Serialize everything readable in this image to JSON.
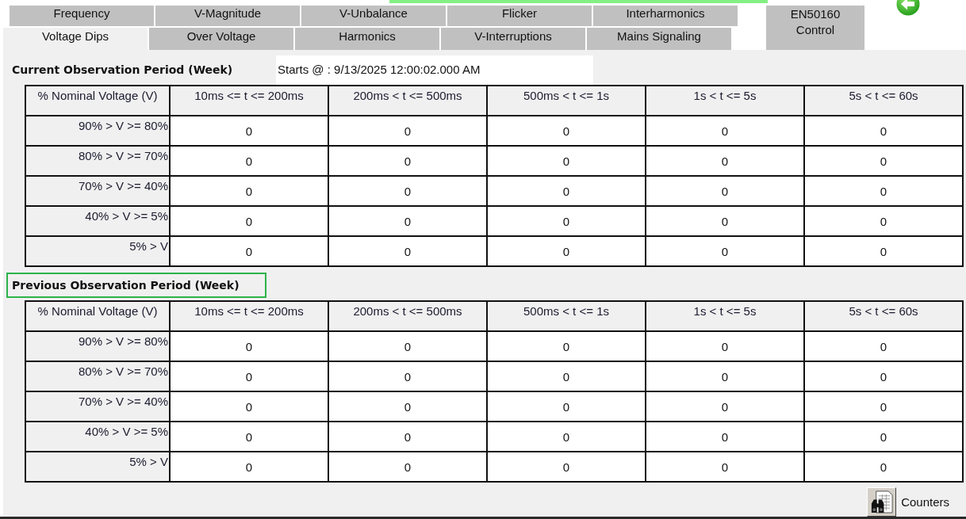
{
  "tabs": {
    "row_1": [
      {
        "label": "Frequency",
        "selected": false
      },
      {
        "label": "V-Magnitude",
        "selected": false
      },
      {
        "label": "V-Unbalance",
        "selected": false
      },
      {
        "label": "Flicker",
        "selected": false
      },
      {
        "label": "Interharmonics",
        "selected": false
      }
    ],
    "row_2": [
      {
        "label": "Voltage Dips",
        "selected": true
      },
      {
        "label": "Over Voltage",
        "selected": false
      },
      {
        "label": "Harmonics",
        "selected": false
      },
      {
        "label": "V-Interruptions",
        "selected": false
      },
      {
        "label": "Mains Signaling",
        "selected": false
      }
    ],
    "side_tab": {
      "label": "EN50160 Control",
      "selected": false
    }
  },
  "sections": [
    {
      "title": "Current Observation Period (Week)",
      "highlighted": false,
      "starts": "Starts @ : 9/13/2025 12:00:02.000 AM",
      "table": {
        "columns": [
          "% Nominal Voltage (V)",
          "10ms <= t <= 200ms",
          "200ms < t <= 500ms",
          "500ms < t <= 1s",
          "1s < t <= 5s",
          "5s < t <= 60s"
        ],
        "rows": [
          {
            "label": "90% > V >= 80%",
            "values": [
              "0",
              "0",
              "0",
              "0",
              "0"
            ]
          },
          {
            "label": "80% > V >= 70%",
            "values": [
              "0",
              "0",
              "0",
              "0",
              "0"
            ]
          },
          {
            "label": "70% > V >= 40%",
            "values": [
              "0",
              "0",
              "0",
              "0",
              "0"
            ]
          },
          {
            "label": "40% > V >= 5%",
            "values": [
              "0",
              "0",
              "0",
              "0",
              "0"
            ]
          },
          {
            "label": "5% > V",
            "values": [
              "0",
              "0",
              "0",
              "0",
              "0"
            ]
          }
        ]
      }
    },
    {
      "title": "Previous Observation Period (Week)",
      "highlighted": true,
      "table": {
        "columns": [
          "% Nominal Voltage (V)",
          "10ms <= t <= 200ms",
          "200ms < t <= 500ms",
          "500ms < t <= 1s",
          "1s < t <= 5s",
          "5s < t <= 60s"
        ],
        "rows": [
          {
            "label": "90% > V >= 80%",
            "values": [
              "0",
              "0",
              "0",
              "0",
              "0"
            ]
          },
          {
            "label": "80% > V >= 70%",
            "values": [
              "0",
              "0",
              "0",
              "0",
              "0"
            ]
          },
          {
            "label": "70% > V >= 40%",
            "values": [
              "0",
              "0",
              "0",
              "0",
              "0"
            ]
          },
          {
            "label": "40% > V >= 5%",
            "values": [
              "0",
              "0",
              "0",
              "0",
              "0"
            ]
          },
          {
            "label": "5% > V",
            "values": [
              "0",
              "0",
              "0",
              "0",
              "0"
            ]
          }
        ]
      }
    }
  ],
  "counters": {
    "label": "Counters"
  }
}
